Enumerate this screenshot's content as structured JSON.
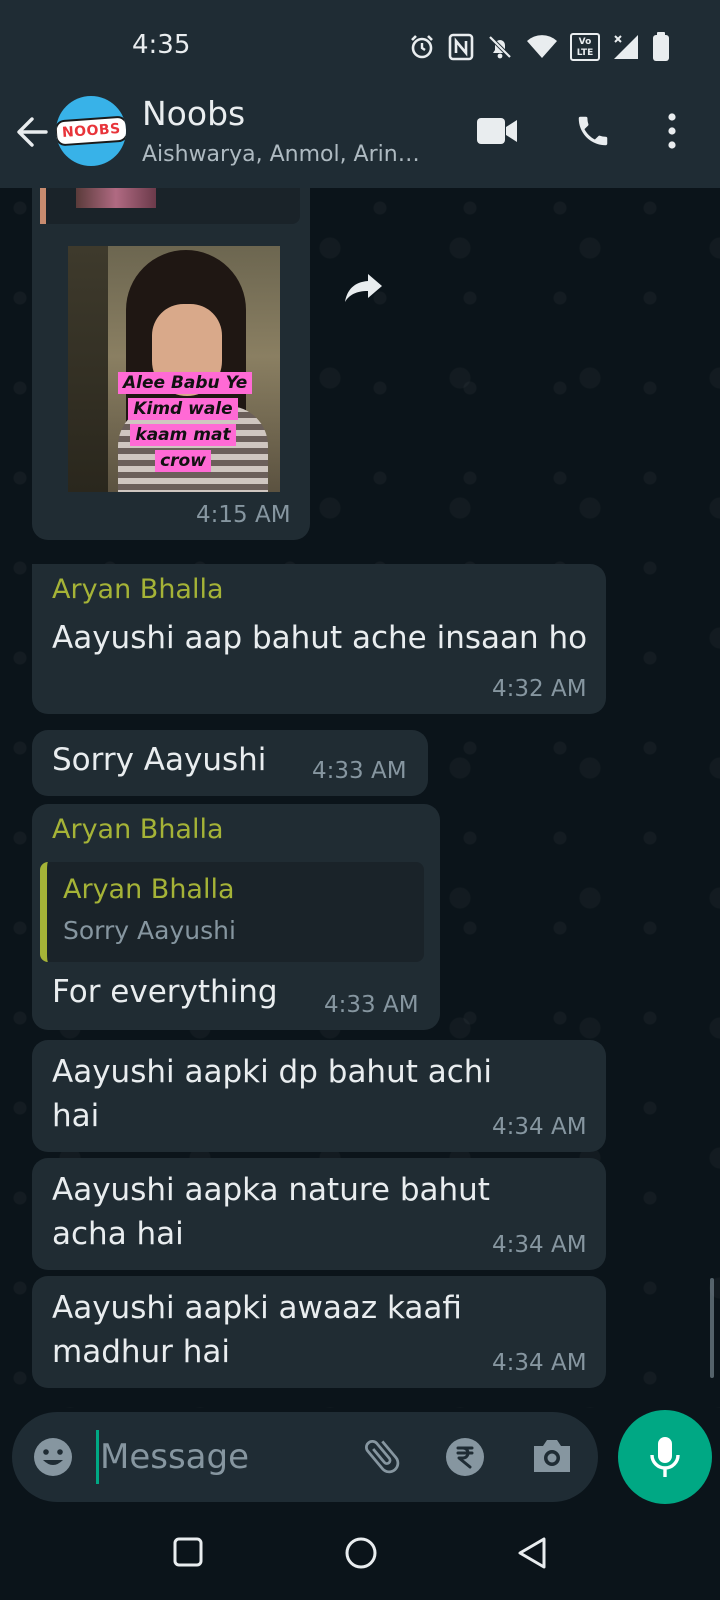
{
  "status_bar": {
    "time": "4:35",
    "icons": [
      "alarm-icon",
      "nfc-icon",
      "mute-icon",
      "wifi-icon",
      "volte-icon",
      "signal-icon",
      "battery-icon"
    ],
    "volte_label": "Vo LTE"
  },
  "header": {
    "group_name": "Noobs",
    "members": "Aishwarya, Anmol, Arin…",
    "avatar_text": "NOOBS"
  },
  "messages": [
    {
      "type": "image",
      "caption": "Alee Babu Ye Kimd wale kaam mat crow",
      "time": "4:15 AM"
    },
    {
      "type": "text",
      "sender": "Aryan Bhalla",
      "text": "Aayushi aap bahut ache insaan ho",
      "time": "4:32 AM"
    },
    {
      "type": "text",
      "text": "Sorry Aayushi",
      "time": "4:33 AM"
    },
    {
      "type": "reply",
      "sender": "Aryan Bhalla",
      "quoted_sender": "Aryan Bhalla",
      "quoted_text": "Sorry Aayushi",
      "text": "For everything",
      "time": "4:33 AM"
    },
    {
      "type": "text",
      "text": "Aayushi aapki dp bahut achi hai",
      "time": "4:34 AM"
    },
    {
      "type": "text",
      "text": "Aayushi aapka nature bahut acha hai",
      "time": "4:34 AM"
    },
    {
      "type": "text",
      "text": "Aayushi aapki awaaz kaafi madhur hai",
      "time": "4:34 AM"
    }
  ],
  "input": {
    "placeholder": "Message"
  },
  "colors": {
    "background": "#0b141a",
    "bar": "#1f2c34",
    "bubble": "#202c33",
    "sender": "#a5b337",
    "accent": "#00a884"
  }
}
